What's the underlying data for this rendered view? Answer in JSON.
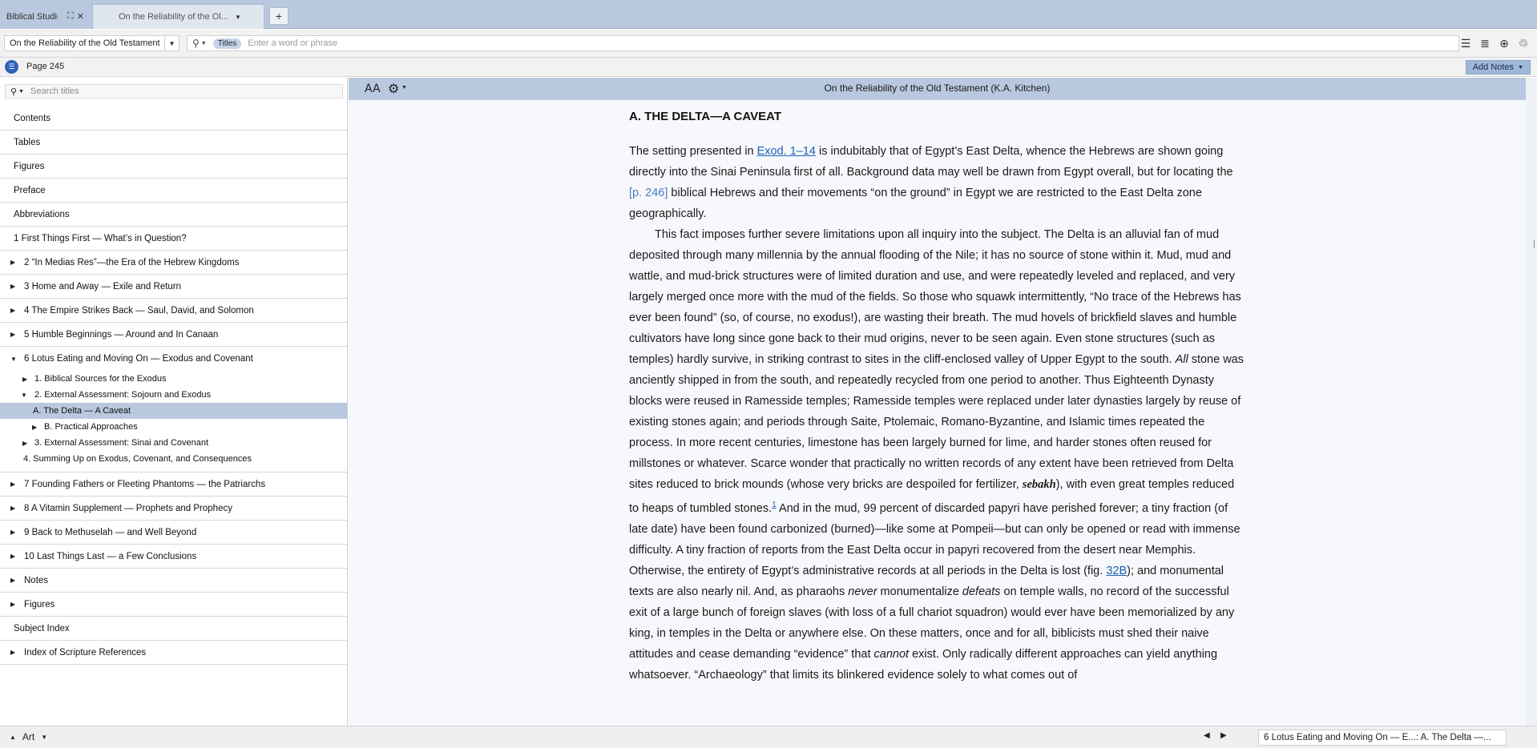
{
  "tabs": [
    {
      "title": "Biblical Studies"
    },
    {
      "title": "On the Reliability of the Ol..."
    }
  ],
  "tab_add_label": "+",
  "toolbar": {
    "resource_title": "On the Reliability of the Old Testament",
    "search_scope": "Titles",
    "search_placeholder": "Enter a word or phrase"
  },
  "pagebar": {
    "page_label": "Page 245",
    "add_notes_label": "Add Notes"
  },
  "sidebar": {
    "search_placeholder": "Search titles",
    "toc": [
      {
        "label": "Contents",
        "has_triangle": false
      },
      {
        "label": "Tables",
        "has_triangle": false
      },
      {
        "label": "Figures",
        "has_triangle": false
      },
      {
        "label": "Preface",
        "has_triangle": false
      },
      {
        "label": "Abbreviations",
        "has_triangle": false
      },
      {
        "label": "1 First Things First — What’s in Question?",
        "has_triangle": false
      },
      {
        "label": "2 “In Medias Res”—the Era of the Hebrew Kingdoms",
        "has_triangle": true
      },
      {
        "label": "3 Home and Away — Exile and Return",
        "has_triangle": true
      },
      {
        "label": "4 The Empire Strikes Back — Saul, David, and Solomon",
        "has_triangle": true
      },
      {
        "label": "5 Humble Beginnings — Around and In Canaan",
        "has_triangle": true
      },
      {
        "label": "6 Lotus Eating and Moving On — Exodus and Covenant",
        "has_triangle": true,
        "expanded": true
      }
    ],
    "toc_sub": [
      {
        "label": "1. Biblical Sources for the Exodus",
        "level": 1,
        "has_triangle": true,
        "expanded": false,
        "selected": false
      },
      {
        "label": "2. External Assessment: Sojourn and Exodus",
        "level": 1,
        "has_triangle": true,
        "expanded": true,
        "selected": false
      },
      {
        "label": "A. The Delta — A Caveat",
        "level": 2,
        "has_triangle": false,
        "expanded": false,
        "selected": true
      },
      {
        "label": "B. Practical Approaches",
        "level": 2,
        "has_triangle": true,
        "expanded": false,
        "selected": false
      },
      {
        "label": "3. External Assessment: Sinai and Covenant",
        "level": 1,
        "has_triangle": true,
        "expanded": false,
        "selected": false
      },
      {
        "label": "4. Summing Up on Exodus, Covenant, and Consequences",
        "level": 1,
        "has_triangle": false,
        "expanded": false,
        "selected": false
      }
    ],
    "toc_after": [
      {
        "label": "7 Founding Fathers or Fleeting Phantoms — the Patriarchs",
        "has_triangle": true
      },
      {
        "label": "8 A Vitamin Supplement — Prophets and Prophecy",
        "has_triangle": true
      },
      {
        "label": "9 Back to Methuselah — and Well Beyond",
        "has_triangle": true
      },
      {
        "label": "10 Last Things Last — a Few Conclusions",
        "has_triangle": true
      },
      {
        "label": "Notes",
        "has_triangle": true
      },
      {
        "label": "Figures",
        "has_triangle": true
      },
      {
        "label": "Subject Index",
        "has_triangle": false
      },
      {
        "label": "Index of Scripture References",
        "has_triangle": true
      }
    ]
  },
  "reader": {
    "font_icon_label": "AA",
    "title": "On the Reliability of the Old Testament (K.A. Kitchen)",
    "heading": "A. THE DELTA—A CAVEAT",
    "p1_a": "The setting presented in ",
    "p1_ref": "Exod. 1–14",
    "p1_b": " is indubitably that of Egypt’s East Delta, whence the Hebrews are shown going directly into the Sinai Peninsula first of all. Background data may well be drawn from Egypt overall, but for locating the ",
    "p1_page": "[p. 246]",
    "p1_c": " biblical Hebrews and their movements “on the ground” in Egypt we are restricted to the East Delta zone geographically.",
    "p2_a": "This fact imposes further severe limitations upon all inquiry into the subject. The Delta is an alluvial fan of mud deposited through many millennia by the annual flooding of the Nile; it has no source of stone within it. Mud, mud and wattle, and mud-brick structures were of limited duration and use, and were repeatedly leveled and replaced, and very largely merged once more with the mud of the fields. So those who squawk intermittently, “No trace of the Hebrews has ever been found” (so, of course, no exodus!), are wasting their breath. The mud hovels of brickfield slaves and humble cultivators have long since gone back to their mud origins, never to be seen again. Even stone structures (such as temples) hardly survive, in striking contrast to sites in the cliff-enclosed valley of Upper Egypt to the south. ",
    "p2_all": "All",
    "p2_b": " stone was anciently shipped in from the south, and repeatedly recycled from one period to another. Thus Eighteenth Dynasty blocks were reused in Ramesside temples; Ramesside temples were replaced under later dynasties largely by reuse of existing stones again; and periods through Saite, Ptolemaic, Romano-Byzantine, and Islamic times repeated the process. In more recent centuries, limestone has been largely burned for lime, and harder stones often reused for millstones or whatever. Scarce wonder that practically no written records of any extent have been retrieved from Delta sites reduced to brick mounds (whose very bricks are despoiled for fertilizer, ",
    "p2_sebakh": "sebakh",
    "p2_c": "), with even great temples reduced to heaps of tumbled stones.",
    "p2_note": "1",
    "p2_d": " And in the mud, 99 percent of discarded papyri have perished forever; a tiny fraction (of late date) have been found carbonized (burned)—like some at Pompeii—but can only be opened or read with immense difficulty. A tiny fraction of reports from the East Delta occur in papyri recovered from the desert near Memphis. Otherwise, the entirety of Egypt’s administrative records at all periods in the Delta is lost (fig. ",
    "p2_fig": "32B",
    "p2_e": "); and monumental texts are also nearly nil. And, as pharaohs ",
    "p2_never": "never",
    "p2_f": " monumentalize ",
    "p2_defeats": "defeats",
    "p2_g": " on temple walls, no record of the successful exit of a large bunch of foreign slaves (with loss of a full chariot squadron) would ever have been memorialized by any king, in temples in the Delta or anywhere else. On these matters, once and for all, biblicists must shed their naive attitudes and cease demanding “evidence” that ",
    "p2_cannot": "cannot",
    "p2_h": " exist. Only radically different approaches can yield anything whatsoever. “Archaeology” that limits its blinkered evidence solely to what comes out of"
  },
  "statusbar": {
    "art_label": "Art",
    "location": "6 Lotus Eating and Moving On — E...: A. The Delta —..."
  }
}
